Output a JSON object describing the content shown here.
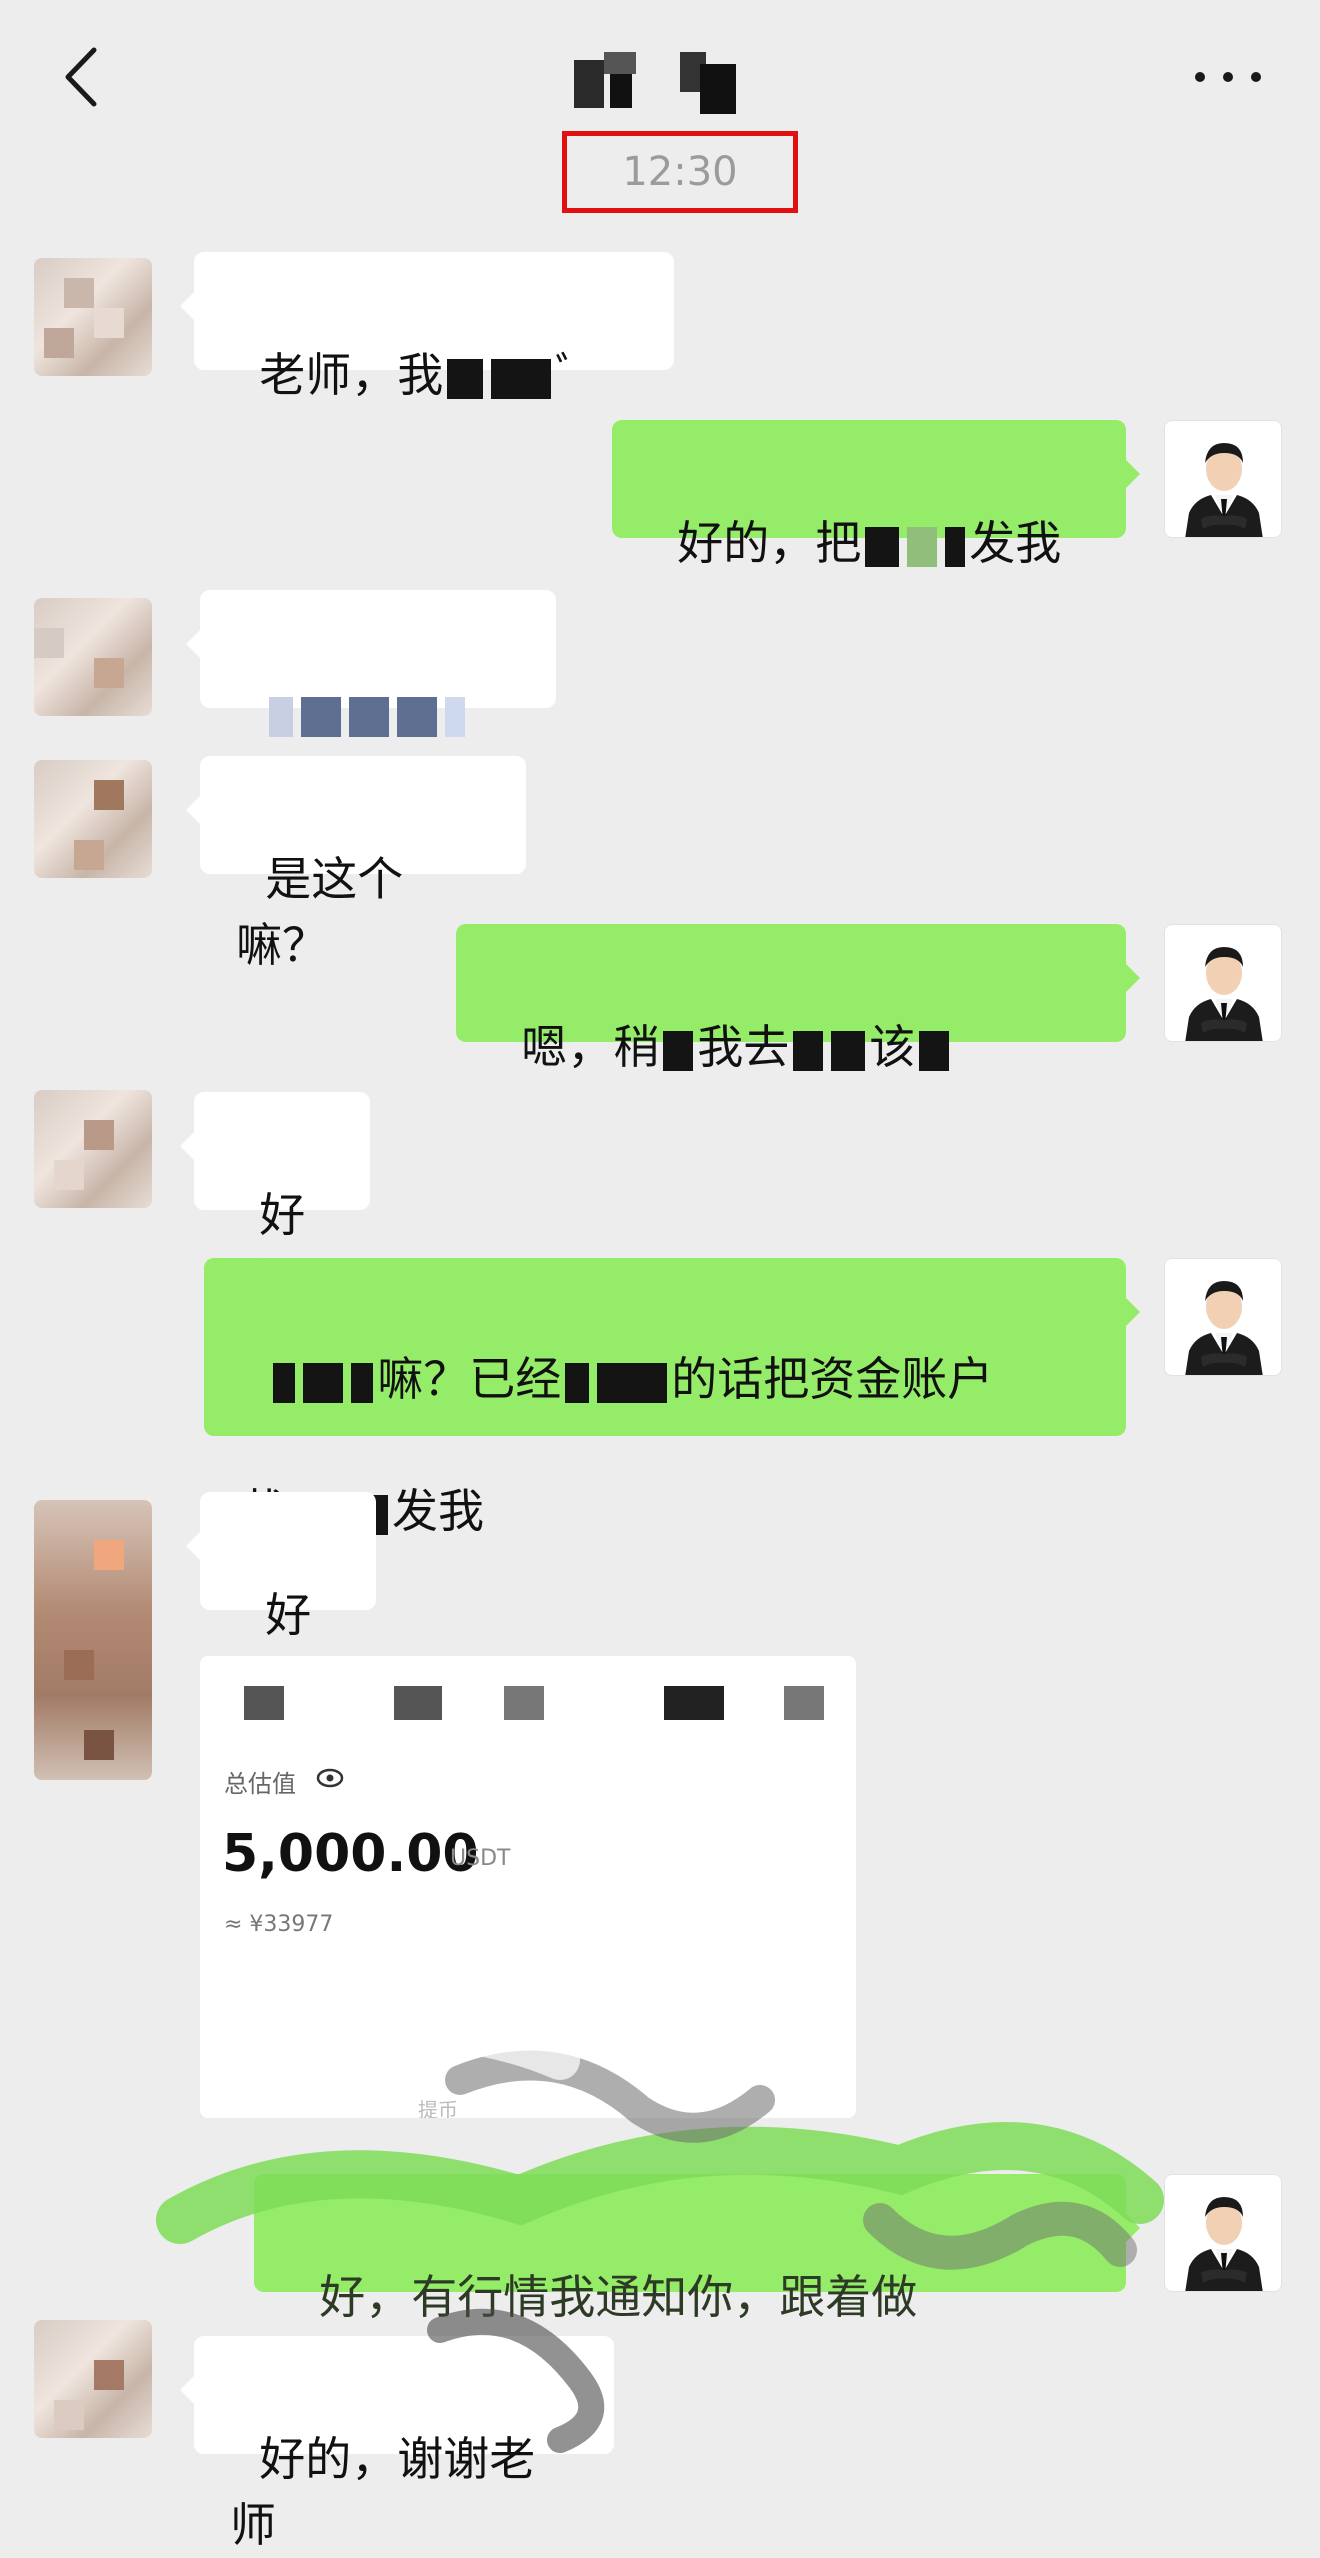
{
  "header": {
    "timestamp": "12:30"
  },
  "messages": [
    {
      "side": "left",
      "text_pre": "老师，我",
      "text_post": "ﾞ"
    },
    {
      "side": "right",
      "text_pre": "好的，把",
      "text_post": "发我"
    },
    {
      "side": "left",
      "text_pre": "",
      "text_post": ""
    },
    {
      "side": "left",
      "text_pre": "是这个嘛？",
      "text_post": ""
    },
    {
      "side": "right",
      "text_pre": "嗯，稍",
      "text_mid": "我去",
      "text_post": "该"
    },
    {
      "side": "left",
      "text_pre": "好的",
      "text_post": ""
    },
    {
      "side": "right",
      "text_pre": "嘛？已经",
      "text_mid": "的话把资金账户",
      "text_post": "截",
      "text_end": "发我"
    },
    {
      "side": "left",
      "text_pre": "好的",
      "text_post": ""
    },
    {
      "side": "right",
      "text_pre": "好，有行情我通知你，跟着做",
      "text_post": ""
    },
    {
      "side": "left",
      "text_pre": "好的，谢谢老师",
      "text_post": ""
    }
  ],
  "screenshot_card": {
    "label": "总估值",
    "amount": "5,000.00",
    "unit": "USDT",
    "approx": "≈ ¥33977",
    "withdraw": "提币"
  },
  "icons": {
    "back": "chevron-left-icon",
    "more": "more-dots-icon",
    "eye": "eye-icon"
  },
  "colors": {
    "background": "#ededed",
    "bubble_self": "#95ec69",
    "bubble_other": "#ffffff",
    "timestamp_frame": "#e10f0f"
  }
}
